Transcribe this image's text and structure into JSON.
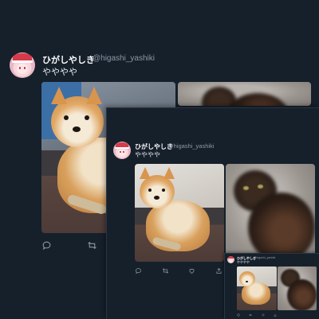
{
  "tweet": {
    "display_name": "ひがしやしき",
    "handle": "@higashi_yashiki",
    "text": "やややや"
  },
  "icons": [
    "reply-icon",
    "retweet-icon",
    "like-icon",
    "share-icon"
  ],
  "colors": {
    "background": "#16202b",
    "text_primary": "#ffffff",
    "text_secondary": "#8b98a5"
  }
}
